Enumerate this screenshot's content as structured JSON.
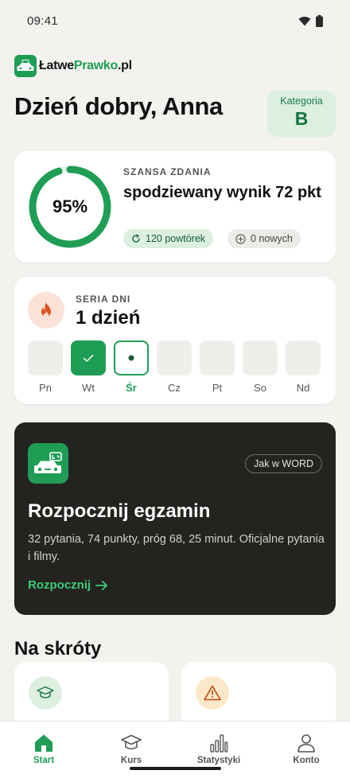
{
  "status_bar": {
    "time": "09:41"
  },
  "brand": {
    "part1": "Łatwe",
    "part2": "Prawko",
    "part3": ".pl"
  },
  "greeting": "Dzień dobry, Anna",
  "category": {
    "label": "Kategoria",
    "value": "B"
  },
  "chance": {
    "percent_label": "95%",
    "progress": 0.95,
    "eyebrow": "SZANSA ZDANIA",
    "title": "spodziewany wynik 72 pkt",
    "repeats_label": "120 powtórek",
    "new_label": "0 nowych"
  },
  "streak": {
    "eyebrow": "SERIA DNI",
    "value": "1 dzień",
    "days": [
      {
        "label": "Pn",
        "state": "empty"
      },
      {
        "label": "Wt",
        "state": "done"
      },
      {
        "label": "Śr",
        "state": "today"
      },
      {
        "label": "Cz",
        "state": "empty"
      },
      {
        "label": "Pt",
        "state": "empty"
      },
      {
        "label": "So",
        "state": "empty"
      },
      {
        "label": "Nd",
        "state": "empty"
      }
    ]
  },
  "exam": {
    "badge": "Jak w WORD",
    "title": "Rozpocznij egzamin",
    "description": "32 pytania, 74 punkty, próg 68, 25 minut. Oficjalne pytania i filmy.",
    "cta": "Rozpocznij"
  },
  "shortcuts": {
    "title": "Na skróty",
    "items": [
      {
        "icon": "graduation-cap-icon"
      },
      {
        "icon": "warning-triangle-icon"
      }
    ]
  },
  "nav": {
    "items": [
      {
        "label": "Start",
        "icon": "home-icon",
        "active": true
      },
      {
        "label": "Kurs",
        "icon": "graduation-cap-icon",
        "active": false
      },
      {
        "label": "Statystyki",
        "icon": "bar-chart-icon",
        "active": false
      },
      {
        "label": "Konto",
        "icon": "user-icon",
        "active": false
      }
    ]
  },
  "colors": {
    "accent": "#1f9d55",
    "background": "#f3f2ef",
    "dark_card": "#242320",
    "cta_green": "#3ccd78"
  }
}
